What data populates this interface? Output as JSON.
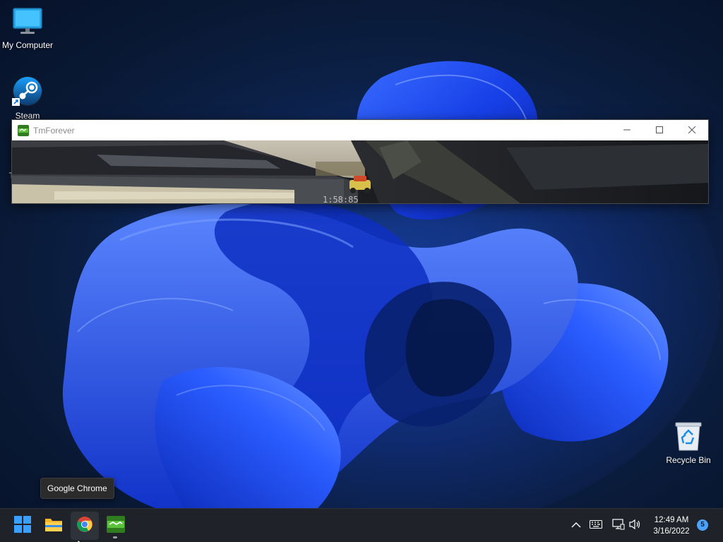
{
  "desktop": {
    "icons": [
      {
        "label": "My Computer",
        "icon": "monitor-icon"
      },
      {
        "label": "Steam",
        "icon": "steam-icon"
      },
      {
        "label": "Tm",
        "icon": "tmforever-shortcut-icon"
      },
      {
        "label": "Recycle Bin",
        "icon": "recycle-bin-icon"
      }
    ]
  },
  "window": {
    "title": "TmForever",
    "app_icon": "tmforever-icon",
    "controls": [
      "minimize-icon",
      "maximize-icon",
      "close-icon"
    ]
  },
  "taskbar": {
    "apps": [
      {
        "name": "Start",
        "icon": "windows-start-icon"
      },
      {
        "name": "File Explorer",
        "icon": "folder-icon"
      },
      {
        "name": "Google Chrome",
        "icon": "chrome-icon",
        "hovered": true
      },
      {
        "name": "TmForever",
        "icon": "tmforever-icon",
        "running": true
      }
    ],
    "tooltip": "Google Chrome",
    "tray": {
      "icons": [
        "chevron-up-icon",
        "keyboard-icon",
        "network-icon",
        "volume-icon"
      ],
      "time": "12:49 AM",
      "date": "3/16/2022",
      "notification_count": "5"
    }
  },
  "colors": {
    "wallpaper_accent": "#1f4fff",
    "taskbar_bg": "#1f2228",
    "notification_badge": "#4aa3ff"
  }
}
